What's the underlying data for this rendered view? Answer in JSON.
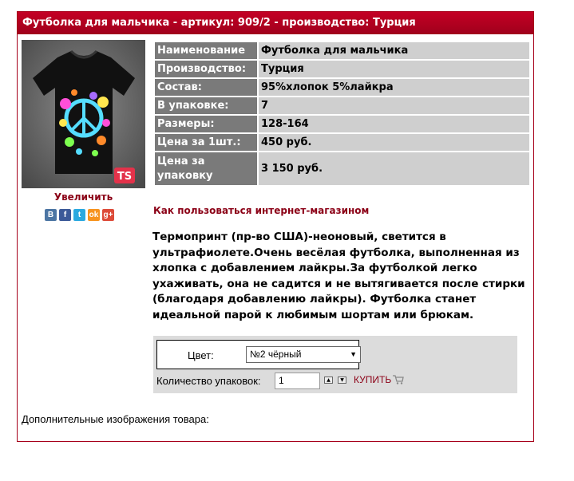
{
  "header": {
    "title": "Футболка для мальчика - артикул: 909/2 - производство: Турция"
  },
  "image": {
    "enlarge_label": "Увеличить"
  },
  "social": [
    {
      "name": "vk-icon",
      "glyph": "В",
      "color": "#4c75a3"
    },
    {
      "name": "facebook-icon",
      "glyph": "f",
      "color": "#3b5998"
    },
    {
      "name": "twitter-icon",
      "glyph": "t",
      "color": "#2aa9e0"
    },
    {
      "name": "odnoklassniki-icon",
      "glyph": "ok",
      "color": "#f7931e"
    },
    {
      "name": "googleplus-icon",
      "glyph": "g+",
      "color": "#dd4b39"
    }
  ],
  "specs": [
    {
      "label": "Наименование",
      "value": "Футболка для мальчика"
    },
    {
      "label": "Производство:",
      "value": "Турция"
    },
    {
      "label": "Состав:",
      "value": "95%хлопок 5%лайкра"
    },
    {
      "label": "В упаковке:",
      "value": "7"
    },
    {
      "label": "Размеры:",
      "value": "128-164"
    },
    {
      "label": "Цена за 1шт.:",
      "value": "450 руб."
    },
    {
      "label": "Цена за упаковку",
      "value": "3 150 руб."
    }
  ],
  "howto_link": "Как пользоваться интернет-магазином",
  "description": "Термопринт (пр-во США)-неоновый, светится в ультрафиолете.Очень весёлая футболка, выполненная из хлопка с добавлением лайкры.За футболкой легко  ухаживать, она не  садится и не вытягивается после  стирки (благодаря добавлению лайкры). Футболка станет идеальной парой к любимым шортам или брюкам.",
  "order": {
    "color_label": "Цвет:",
    "color_selected": "№2 чёрный",
    "qty_label": "Количество упаковок:",
    "qty_value": "1",
    "buy_label": "КУПИТЬ"
  },
  "extra_images_label": "Дополнительные изображения товара:"
}
